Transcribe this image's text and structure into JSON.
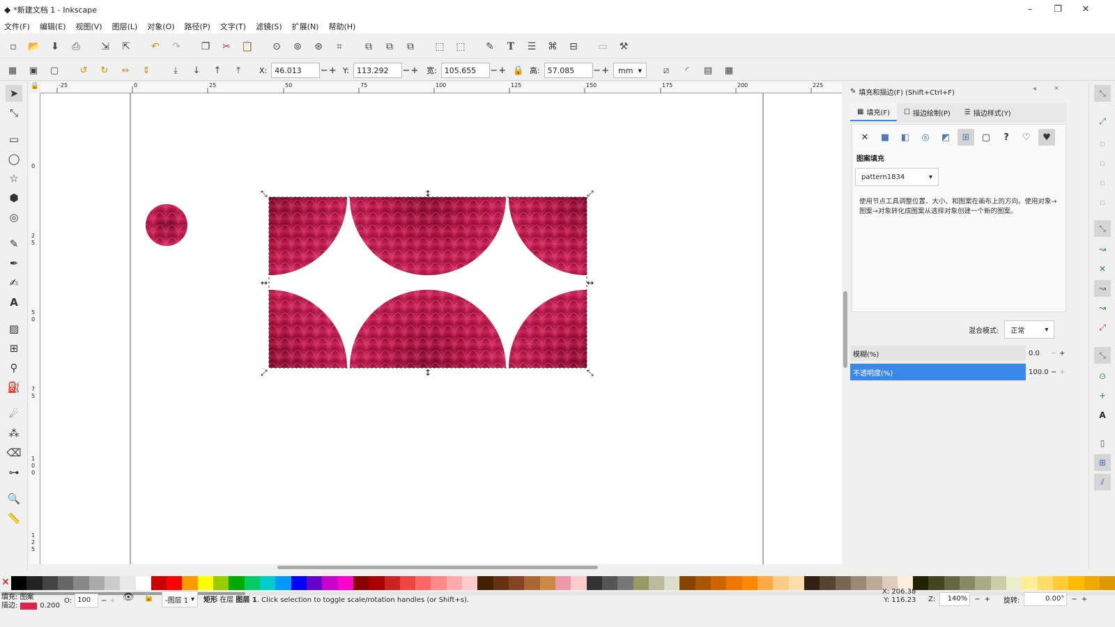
{
  "title": "*新建文档 1 - Inkscape",
  "window": {
    "minimize": "–",
    "maximize": "❐",
    "close": "✕"
  },
  "menu": [
    "文件(F)",
    "编辑(E)",
    "视图(V)",
    "图层(L)",
    "对象(O)",
    "路径(P)",
    "文字(T)",
    "滤镜(S)",
    "扩展(N)",
    "帮助(H)"
  ],
  "controls": {
    "x_label": "X:",
    "x_value": "46.013",
    "y_label": "Y:",
    "y_value": "113.292",
    "w_label": "宽:",
    "w_value": "105.655",
    "h_label": "高:",
    "h_value": "57.085",
    "unit": "mm"
  },
  "rulers": {
    "h_ticks": [
      "-25",
      "0",
      "25",
      "50",
      "75",
      "100",
      "125",
      "150",
      "175",
      "200",
      "225"
    ],
    "v_ticks": [
      "0",
      "2",
      "5",
      "5",
      "0",
      "7",
      "5",
      "1",
      "0",
      "0",
      "1",
      "2",
      "5"
    ]
  },
  "panel": {
    "title": "填充和描边(F) (Shift+Ctrl+F)",
    "tabs": [
      "填充(F)",
      "描边绘制(P)",
      "描边样式(Y)"
    ],
    "pattern_heading": "图案填充",
    "pattern_name": "pattern1834",
    "help_text": "使用节点工具调整位置、大小、和图案在画布上的方向。使用对象→图案→对象转化成图案从选择对象创建一个新的图案。",
    "blend_label": "混合模式:",
    "blend_value": "正常",
    "blur_label": "模糊(%)",
    "blur_value": "0.0",
    "opacity_label": "不透明度(%)",
    "opacity_value": "100.0"
  },
  "status": {
    "fill_label": "填充:",
    "fill_value": "图案",
    "stroke_label": "描边:",
    "stroke_width": "0.200",
    "stroke_color": "#e0204a",
    "opacity_label": "O:",
    "opacity_value": "100",
    "layer": "-图层 1",
    "object_type": "矩形",
    "message_prefix": "在层",
    "layer_name": "图层 1",
    "message": ". Click selection to toggle scale/rotation handles (or Shift+s).",
    "cursor_x_label": "X:",
    "cursor_x": "206.38",
    "cursor_y_label": "Y:",
    "cursor_y": "116.23",
    "zoom_label": "Z:",
    "zoom": "140%",
    "rotate_label": "旋转:",
    "rotate": "0.00°"
  },
  "colors": {
    "selection": "#2a6fd1",
    "flower": "#b0153e",
    "accent_blue": "#3a88e8"
  }
}
